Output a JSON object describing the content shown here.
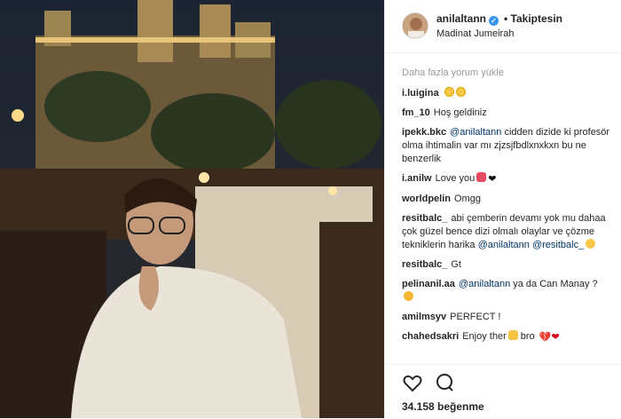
{
  "post": {
    "username": "anilaltann",
    "follow_label": "• Takiptesin",
    "location": "Madinat Jumeirah"
  },
  "comments": {
    "load_more": "Daha fazla yorum yükle",
    "items": [
      {
        "user": "i.luigina",
        "text": "",
        "emoji": [
          "smiling-heart-eyes",
          "smiling-heart-eyes"
        ]
      },
      {
        "user": "fm_10",
        "text": "Hoş geldiniz"
      },
      {
        "user": "ipekk.bkc",
        "mention": "@anilaltann",
        "text": "cidden dizide ki profesör olma ihtimalin var mı zjzsjfbdlxnxkxn bu ne benzerlik"
      },
      {
        "user": "i.anilw",
        "text": "Love you",
        "emoji": [
          "tongue",
          "black-heart"
        ]
      },
      {
        "user": "worldpelin",
        "text": "Omgg"
      },
      {
        "user": "resitbalc_",
        "text": "abi çemberin devamı yok mu dahaa çok güzel bence dizi olmalı olaylar ve çözme tekniklerin harika",
        "mention": "@anilaltann",
        "mention2": "@resitbalc_",
        "emoji": [
          "cool"
        ]
      },
      {
        "user": "resitbalc_",
        "text": "Gt"
      },
      {
        "user": "pelinanil.aa",
        "mention": "@anilaltann",
        "text": "ya da Can Manay ?",
        "emoji": [
          "laughing"
        ]
      },
      {
        "user": "amilmsyv",
        "text": "PERFECT !"
      },
      {
        "user": "chahedsakri",
        "text": "Enjoy ther",
        "text2": "bro",
        "emoji": [
          "hand",
          "hearts"
        ]
      }
    ]
  },
  "actions": {
    "likes": "34.158 beğenme"
  }
}
